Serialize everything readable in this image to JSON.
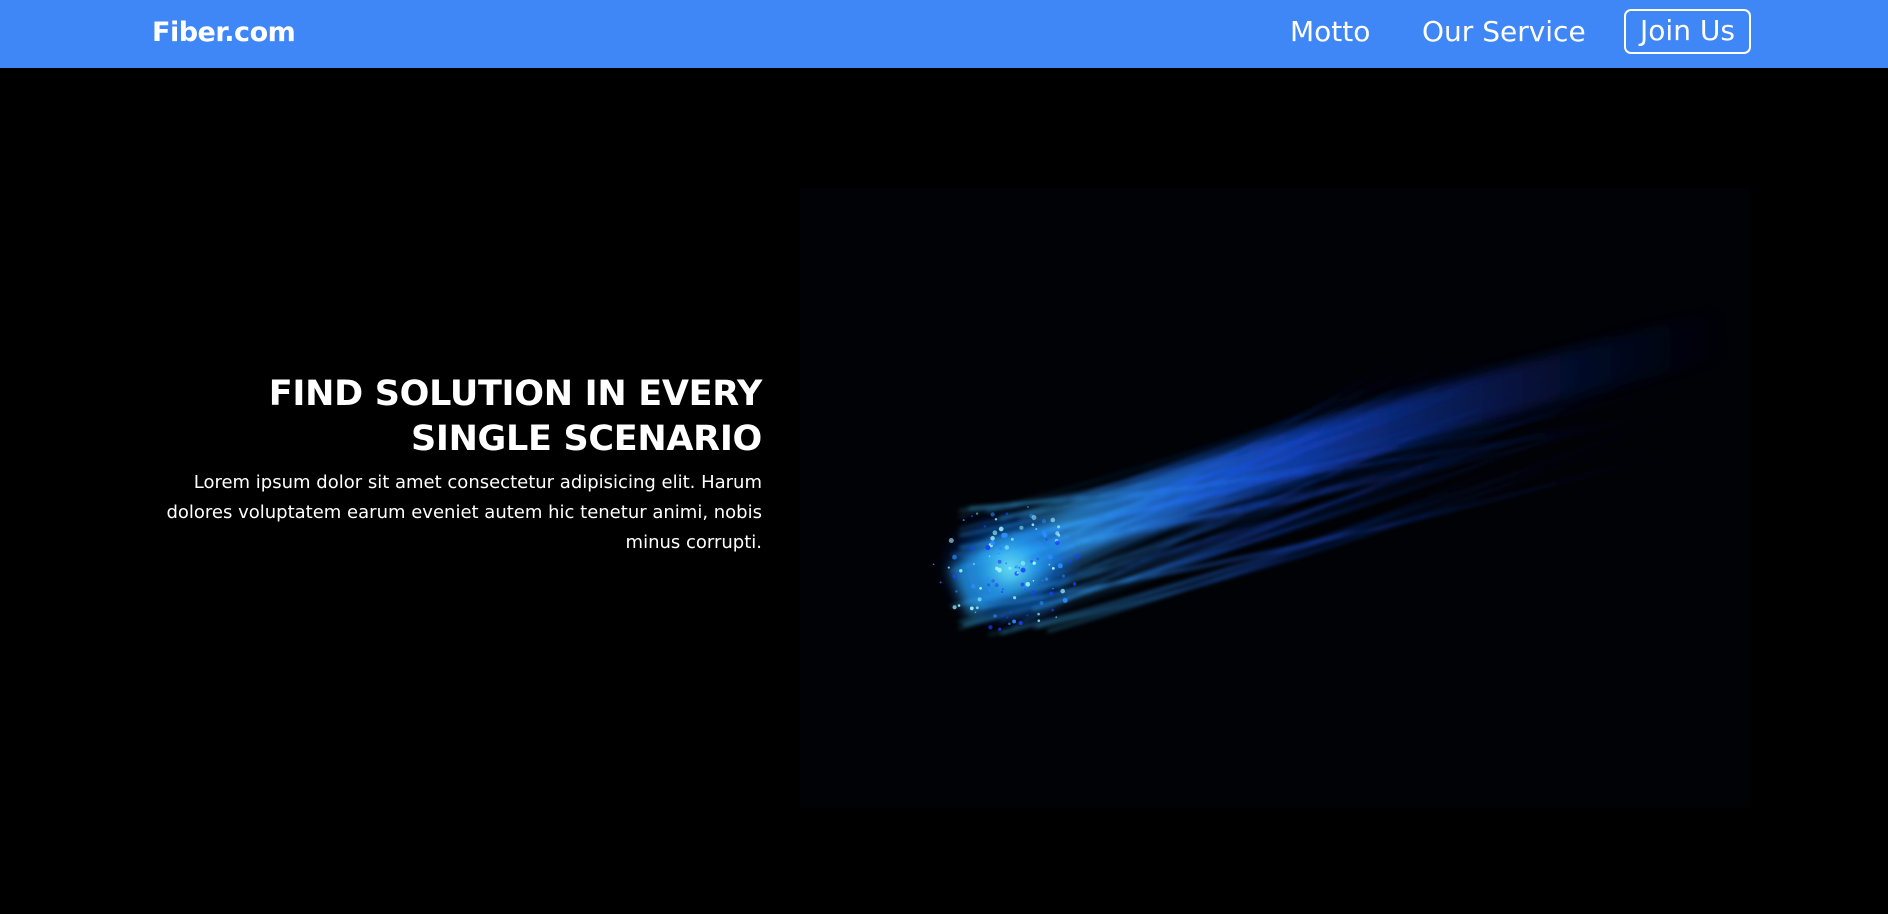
{
  "navbar": {
    "brand": "Fiber.com",
    "links": [
      {
        "label": "Motto"
      },
      {
        "label": "Our Service"
      }
    ],
    "join_label": "Join Us",
    "bg_color": "#3f86f6"
  },
  "hero": {
    "title": "FIND SOLUTION IN EVERY SINGLE SCENARIO",
    "description": "Lorem ipsum dolor sit amet consectetur adipisicing elit. Harum dolores voluptatem earum eveniet autem hic tenetur animi, nobis minus corrupti.",
    "image_icon": "fiber-optic-image"
  }
}
